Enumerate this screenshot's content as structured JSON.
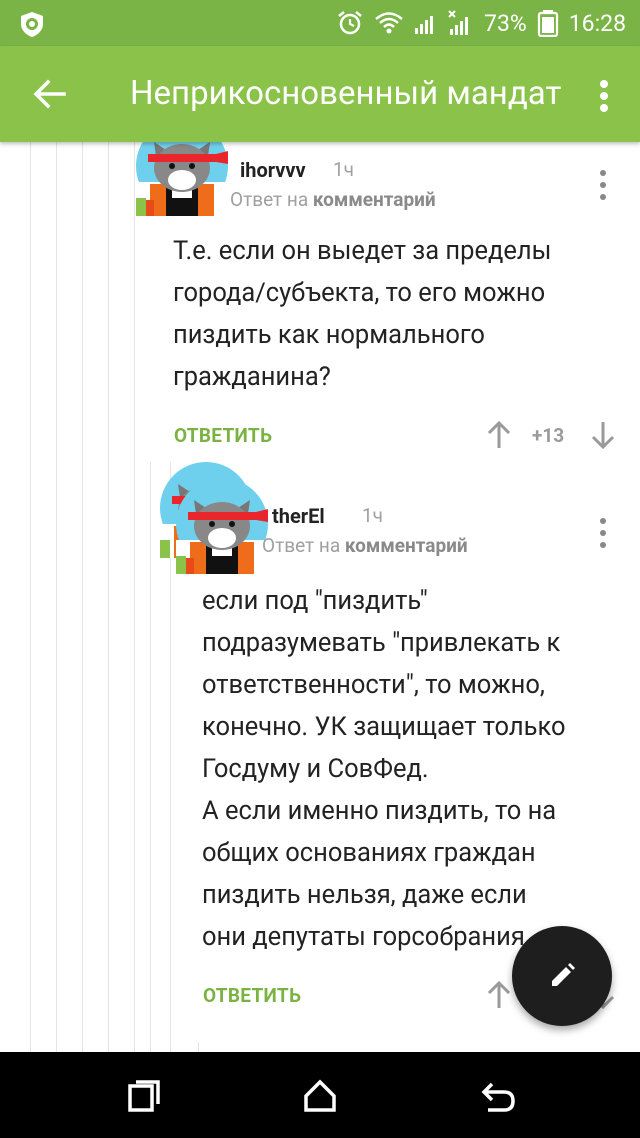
{
  "status_bar": {
    "battery": "73%",
    "time": "16:28",
    "icons": [
      "app-shield-icon",
      "alarm-icon",
      "wifi-icon",
      "signal-icon",
      "signal-no-sim-icon",
      "battery-icon"
    ]
  },
  "app_bar": {
    "title": "Неприкосновенный мандат",
    "back_icon": "arrow-left-icon",
    "menu_icon": "more-vert-icon"
  },
  "colors": {
    "accent": "#8bc34a",
    "status_bar": "#7bb446",
    "reply_link": "#7ab342",
    "fab": "#1e1e1e"
  },
  "comments": [
    {
      "username": "ihorvvv",
      "time": "1ч",
      "reply_prefix": "Ответ на ",
      "reply_target": "комментарий",
      "body_lines": [
        "Т.е. если он выедет за пределы",
        "города/субъекта, то его можно",
        "пиздить как нормального",
        "гражданина?"
      ],
      "reply_label": "ОТВЕТИТЬ",
      "rating": "+13"
    },
    {
      "username": "therEl",
      "time": "1ч",
      "reply_prefix": "Ответ на ",
      "reply_target": "комментарий",
      "body_lines": [
        "если под \"пиздить\"",
        "подразумевать \"привлекать к",
        "ответственности\", то можно,",
        "конечно. УК защищает только",
        "Госдуму и СовФед.",
        "А если именно пиздить, то на",
        "общих основаниях граждан",
        "пиздить нельзя, даже если",
        "они депутаты горсобрания"
      ],
      "reply_label": "ОТВЕТИТЬ"
    }
  ],
  "fab": {
    "icon": "pencil-icon"
  },
  "nav_bar": {
    "icons": [
      "recent-apps-icon",
      "home-icon",
      "back-icon"
    ]
  }
}
